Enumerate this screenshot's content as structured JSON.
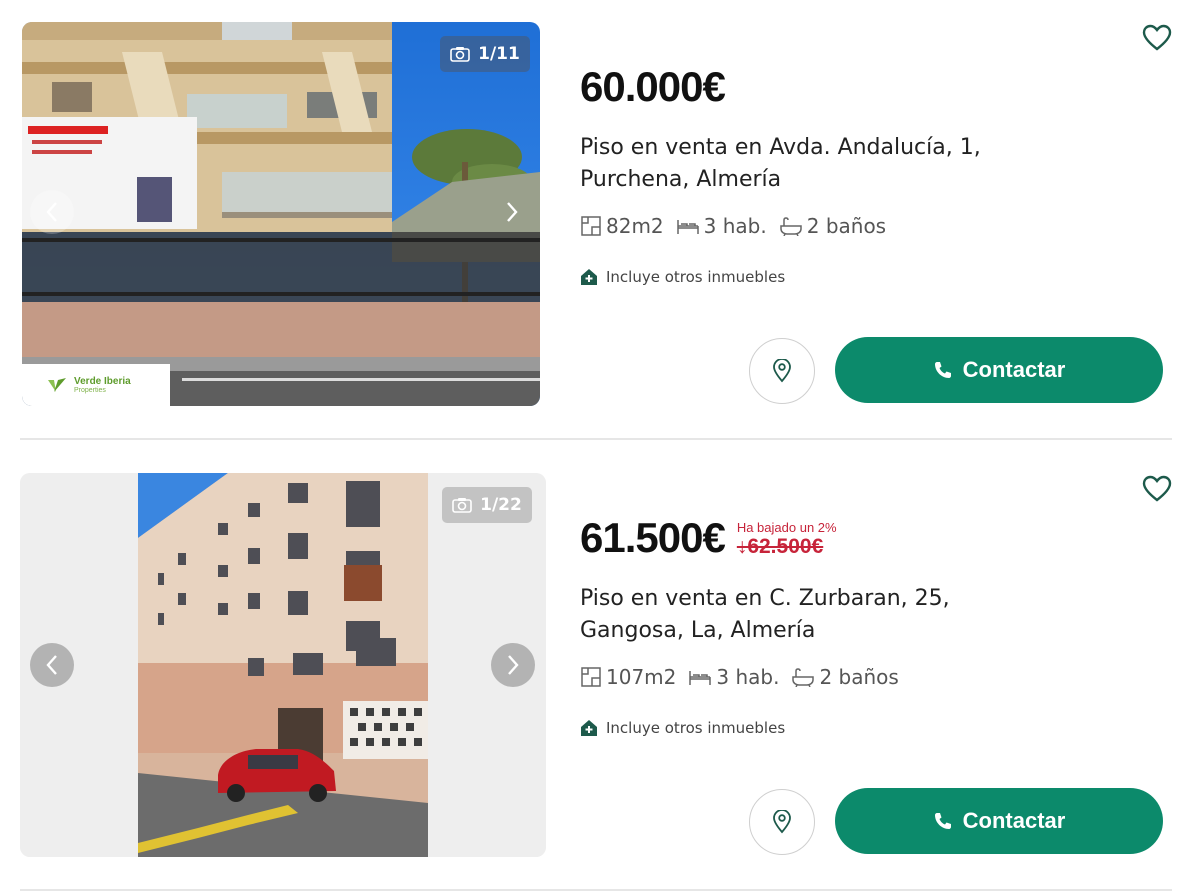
{
  "listings": [
    {
      "photo_counter": "1/11",
      "price": "60.000€",
      "title": "Piso en venta en Avda. Andalucía, 1, Purchena, Almería",
      "area": "82m2",
      "rooms": "3 hab.",
      "baths": "2 baños",
      "includes": "Incluye otros inmuebles",
      "agency": {
        "name": "Verde Iberia",
        "sub": "Properties"
      },
      "contact_label": "Contactar"
    },
    {
      "photo_counter": "1/22",
      "price": "61.500€",
      "price_drop_note": "Ha bajado un 2%",
      "old_price": "↓62.500€",
      "title": "Piso en venta en C. Zurbaran, 25, Gangosa, La, Almería",
      "area": "107m2",
      "rooms": "3 hab.",
      "baths": "2 baños",
      "includes": "Incluye otros inmuebles",
      "contact_label": "Contactar"
    }
  ],
  "icons": {
    "favorite": "heart-icon",
    "camera": "camera-icon",
    "prev": "chevron-left-icon",
    "next": "chevron-right-icon",
    "area": "floor-plan-icon",
    "rooms": "bed-icon",
    "baths": "bathtub-icon",
    "includes": "house-plus-icon",
    "map": "location-pin-icon",
    "phone": "phone-icon"
  },
  "colors": {
    "accent": "#0c8a6b",
    "price_drop": "#c7243a",
    "icon_green": "#1d5a4b"
  }
}
